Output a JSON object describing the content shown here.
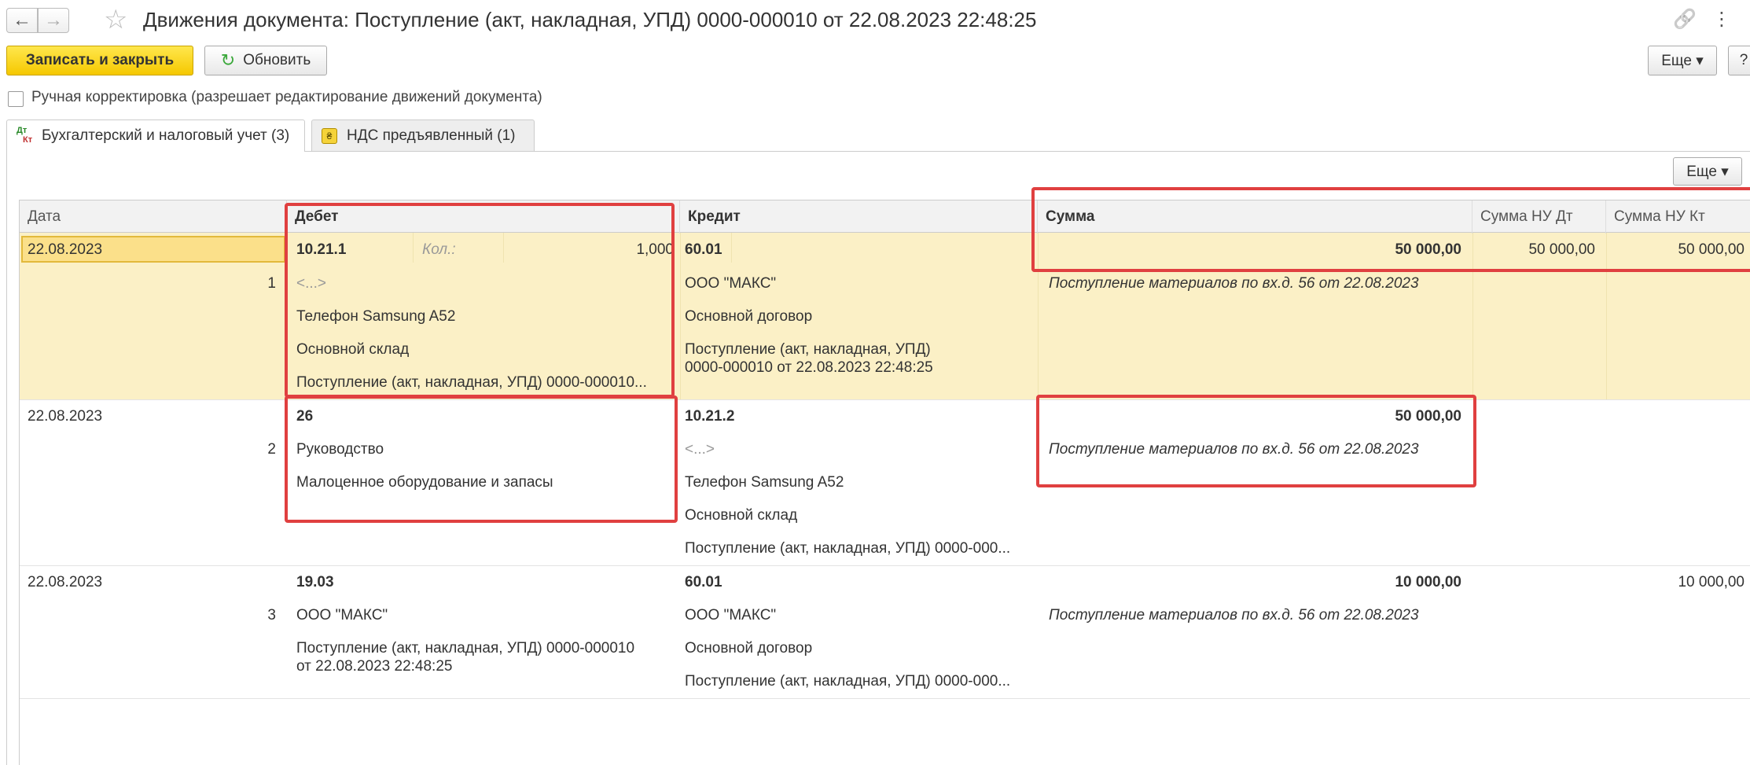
{
  "window": {
    "title": "Движения документа: Поступление (акт, накладная, УПД) 0000-000010 от 22.08.2023 22:48:25",
    "back_icon": "←",
    "forward_icon": "→",
    "star_icon": "☆",
    "link_icon": "🔗",
    "kebab_icon": "⋮"
  },
  "toolbar": {
    "save_close": "Записать и закрыть",
    "refresh": "Обновить",
    "refresh_icon": "↻",
    "more": "Еще ▾",
    "help": "?"
  },
  "manual_edit": {
    "label": "Ручная корректировка (разрешает редактирование движений документа)",
    "checked": false
  },
  "tabs": [
    {
      "label": "Бухгалтерский и налоговый учет (3)",
      "icon_top": "Дт",
      "icon_bottom": "Кт"
    },
    {
      "label": "НДС предъявленный (1)",
      "icon": "₴"
    }
  ],
  "table": {
    "more": "Еще ▾",
    "columns": {
      "date": "Дата",
      "debit": "Дебет",
      "credit": "Кредит",
      "sum": "Сумма",
      "sum_nu_dt": "Сумма НУ Дт",
      "sum_nu_kt": "Сумма НУ Кт"
    },
    "rows": [
      {
        "date": "22.08.2023",
        "num": "1",
        "debit_account": "10.21.1",
        "qty_label": "Кол.:",
        "qty": "1,000",
        "debit_sub1": "<...>",
        "debit_sub2": "Телефон Samsung A52",
        "debit_sub3": "Основной склад",
        "debit_sub4": "Поступление (акт, накладная, УПД) 0000-000010...",
        "credit_account": "60.01",
        "credit_sub1": "ООО \"МАКС\"",
        "credit_sub2": "Основной договор",
        "credit_sub3a": "Поступление (акт, накладная, УПД)",
        "credit_sub3b": "0000-000010 от 22.08.2023 22:48:25",
        "sum": "50 000,00",
        "content": "Поступление материалов по вх.д. 56 от 22.08.2023",
        "sum_nu_dt": "50 000,00",
        "sum_nu_kt": "50 000,00"
      },
      {
        "date": "22.08.2023",
        "num": "2",
        "debit_account": "26",
        "debit_sub1": "Руководство",
        "debit_sub2": "Малоценное оборудование и запасы",
        "credit_account": "10.21.2",
        "credit_sub1": "<...>",
        "credit_sub2": "Телефон Samsung A52",
        "credit_sub3": "Основной склад",
        "credit_sub4": "Поступление (акт, накладная, УПД) 0000-000...",
        "sum": "50 000,00",
        "content": "Поступление материалов по вх.д. 56 от 22.08.2023"
      },
      {
        "date": "22.08.2023",
        "num": "3",
        "debit_account": "19.03",
        "debit_sub1": "ООО \"МАКС\"",
        "debit_sub2a": "Поступление (акт, накладная, УПД) 0000-000010",
        "debit_sub2b": "от 22.08.2023 22:48:25",
        "credit_account": "60.01",
        "credit_sub1": "ООО \"МАКС\"",
        "credit_sub2": "Основной договор",
        "credit_sub3": "Поступление (акт, накладная, УПД) 0000-000...",
        "sum": "10 000,00",
        "content": "Поступление материалов по вх.д. 56 от 22.08.2023",
        "sum_nu_kt": "10 000,00"
      }
    ]
  },
  "colors": {
    "primary_button": "#f5c800",
    "selected_row": "#fbf0c6",
    "highlight_box": "#e04040"
  }
}
